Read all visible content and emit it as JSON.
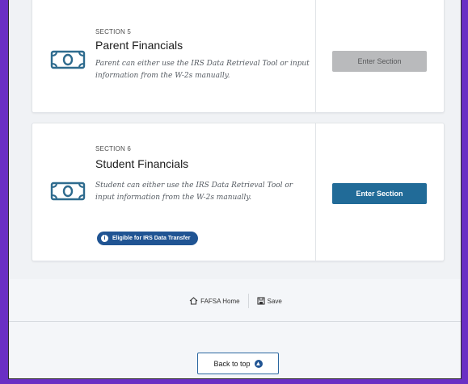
{
  "sections": [
    {
      "number": "SECTION 5",
      "title": "Parent Financials",
      "description": "Parent can either use the IRS Data Retrieval Tool or input information from the W-2s manually.",
      "button_label": "Enter Section",
      "button_state": "disabled"
    },
    {
      "number": "SECTION 6",
      "title": "Student Financials",
      "description": "Student can either use the IRS Data Retrieval Tool or input information from the W-2s manually.",
      "button_label": "Enter Section",
      "button_state": "active",
      "badge": "Eligible for IRS Data Transfer"
    }
  ],
  "footer": {
    "home_label": "FAFSA Home",
    "save_label": "Save",
    "back_to_top_label": "Back to top"
  },
  "colors": {
    "primary_button": "#216b98",
    "disabled_button": "#b9babc",
    "badge": "#205493",
    "money_icon": "#2e6b8e",
    "frame_background": "#6a2fc4"
  },
  "icons": {
    "section_icon": "money-bill-icon",
    "badge_icon": "info-icon",
    "home_icon": "home-icon",
    "save_icon": "save-icon",
    "back_to_top_icon": "arrow-up-circle-icon"
  }
}
